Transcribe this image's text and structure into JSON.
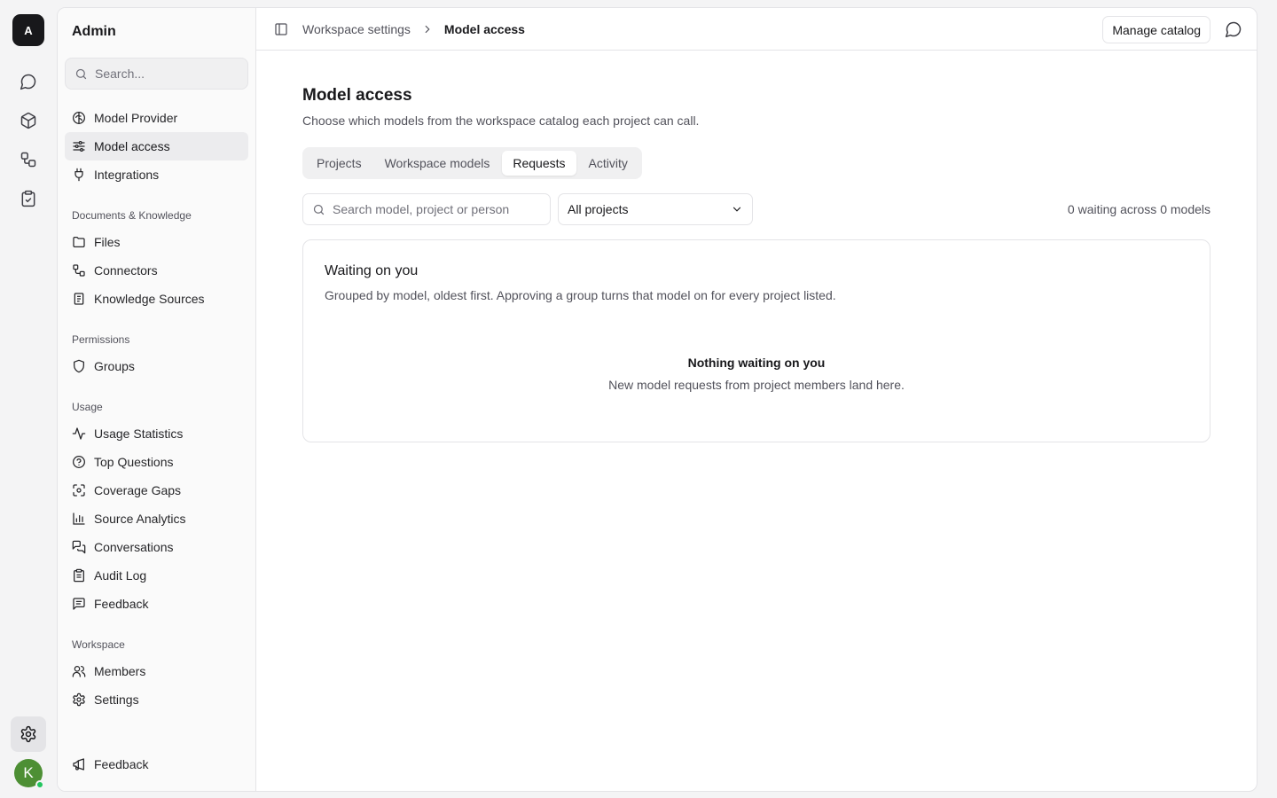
{
  "rail": {
    "workspace_initial": "A",
    "user_initial": "K",
    "items": [
      {
        "icon": "chat-bubble-icon"
      },
      {
        "icon": "cube-icon"
      },
      {
        "icon": "workflow-icon"
      },
      {
        "icon": "clipboard-check-icon"
      }
    ],
    "settings_icon": "gear-icon",
    "status_color": "#22c55e",
    "avatar_color": "#4d8f34"
  },
  "sidebar": {
    "title": "Admin",
    "search_placeholder": "Search...",
    "top_items": [
      {
        "label": "Model Provider",
        "icon": "brain-icon"
      },
      {
        "label": "Model access",
        "icon": "sliders-icon",
        "active": true
      },
      {
        "label": "Integrations",
        "icon": "plug-icon"
      }
    ],
    "sections": [
      {
        "title": "Documents & Knowledge",
        "items": [
          {
            "label": "Files",
            "icon": "folder-icon"
          },
          {
            "label": "Connectors",
            "icon": "connector-icon"
          },
          {
            "label": "Knowledge Sources",
            "icon": "book-icon"
          }
        ]
      },
      {
        "title": "Permissions",
        "items": [
          {
            "label": "Groups",
            "icon": "shield-icon"
          }
        ]
      },
      {
        "title": "Usage",
        "items": [
          {
            "label": "Usage Statistics",
            "icon": "activity-icon"
          },
          {
            "label": "Top Questions",
            "icon": "help-circle-icon"
          },
          {
            "label": "Coverage Gaps",
            "icon": "scan-icon"
          },
          {
            "label": "Source Analytics",
            "icon": "bar-chart-icon"
          },
          {
            "label": "Conversations",
            "icon": "messages-icon"
          },
          {
            "label": "Audit Log",
            "icon": "clipboard-list-icon"
          },
          {
            "label": "Feedback",
            "icon": "message-square-text-icon"
          }
        ]
      },
      {
        "title": "Workspace",
        "items": [
          {
            "label": "Members",
            "icon": "users-icon"
          },
          {
            "label": "Settings",
            "icon": "gear-icon"
          }
        ]
      }
    ],
    "footer": {
      "label": "Feedback",
      "icon": "megaphone-icon"
    }
  },
  "topbar": {
    "breadcrumb_parent": "Workspace settings",
    "breadcrumb_current": "Model access",
    "manage_button": "Manage catalog"
  },
  "page": {
    "title": "Model access",
    "subtitle": "Choose which models from the workspace catalog each project can call.",
    "tabs": [
      {
        "label": "Projects"
      },
      {
        "label": "Workspace models"
      },
      {
        "label": "Requests",
        "active": true
      },
      {
        "label": "Activity"
      }
    ],
    "filters": {
      "search_placeholder": "Search model, project or person",
      "project_select": "All projects",
      "waiting_summary": "0 waiting across 0 models"
    },
    "card": {
      "title": "Waiting on you",
      "subtitle": "Grouped by model, oldest first. Approving a group turns that model on for every project listed.",
      "empty_title": "Nothing waiting on you",
      "empty_subtitle": "New model requests from project members land here."
    }
  }
}
